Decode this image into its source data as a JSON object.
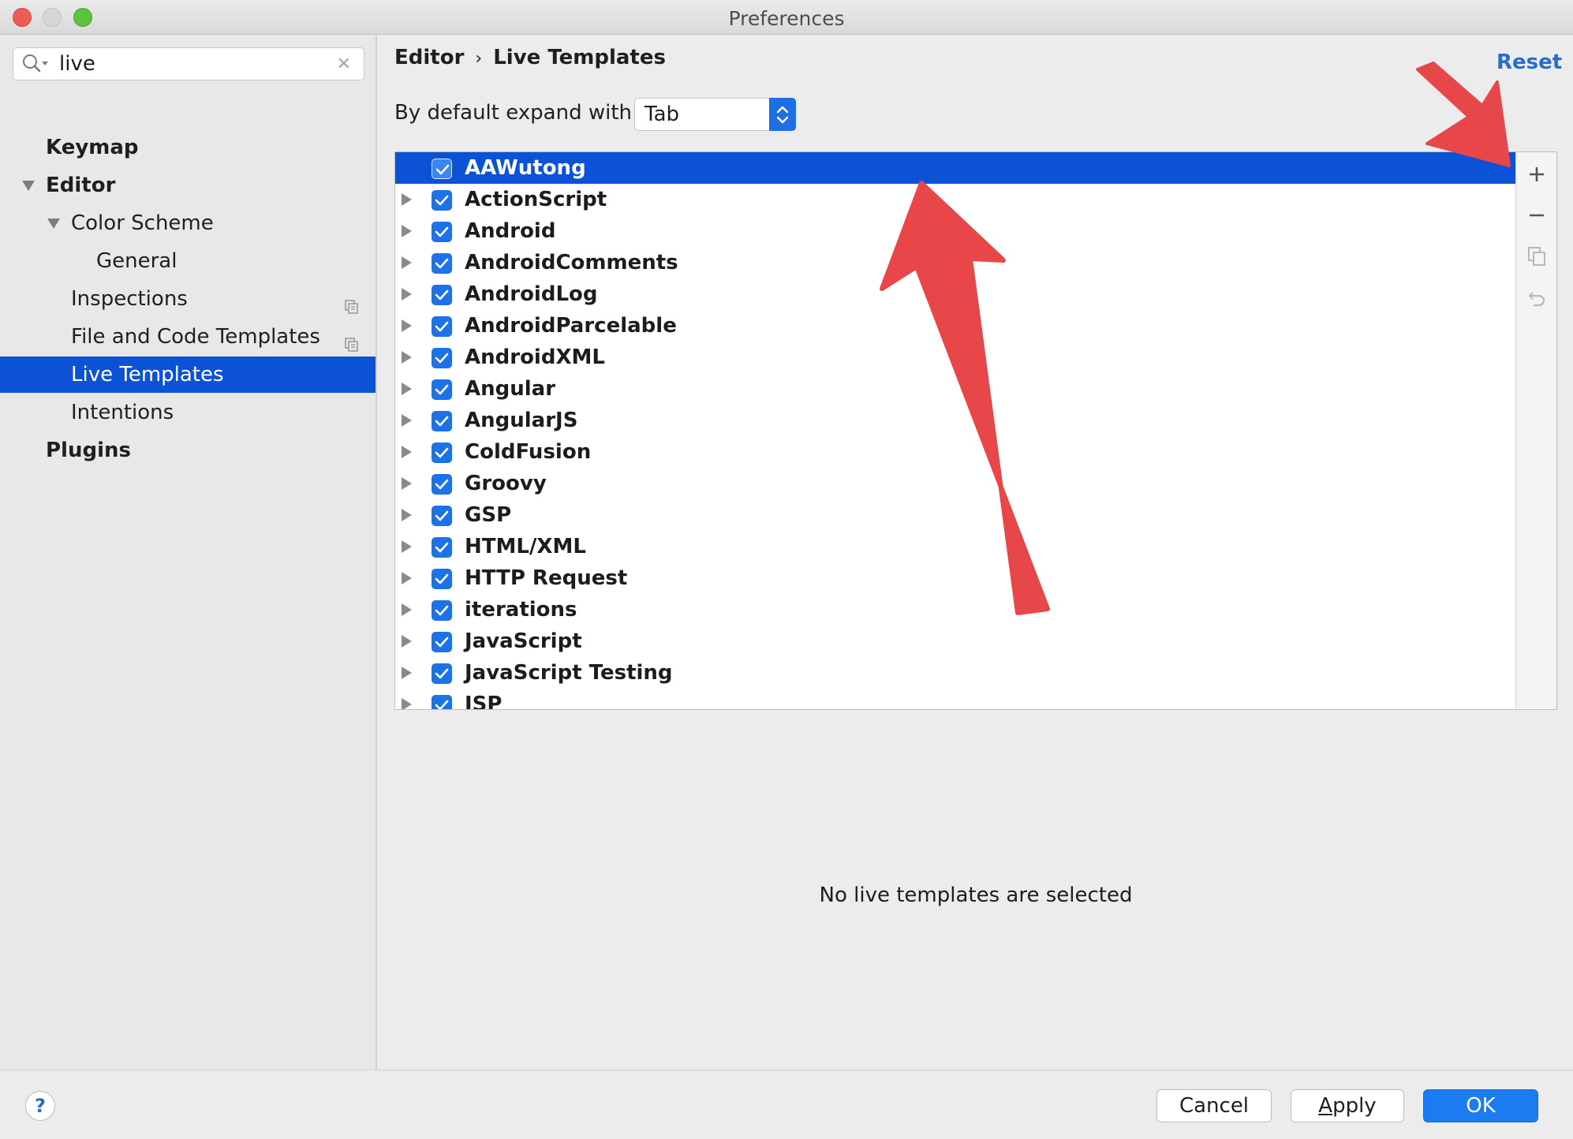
{
  "window": {
    "title": "Preferences"
  },
  "search": {
    "value": "live"
  },
  "sidebar": {
    "items": [
      {
        "label": "Keymap"
      },
      {
        "label": "Editor"
      },
      {
        "label": "Color Scheme"
      },
      {
        "label": "General"
      },
      {
        "label": "Inspections"
      },
      {
        "label": "File and Code Templates"
      },
      {
        "label": "Live Templates"
      },
      {
        "label": "Intentions"
      },
      {
        "label": "Plugins"
      }
    ]
  },
  "breadcrumb": {
    "parent": "Editor",
    "separator": "›",
    "current": "Live Templates"
  },
  "reset": {
    "label": "Reset"
  },
  "expand": {
    "label": "By default expand with",
    "value": "Tab"
  },
  "templates": [
    {
      "name": "AAWutong",
      "checked": true
    },
    {
      "name": "ActionScript",
      "checked": true
    },
    {
      "name": "Android",
      "checked": true
    },
    {
      "name": "AndroidComments",
      "checked": true
    },
    {
      "name": "AndroidLog",
      "checked": true
    },
    {
      "name": "AndroidParcelable",
      "checked": true
    },
    {
      "name": "AndroidXML",
      "checked": true
    },
    {
      "name": "Angular",
      "checked": true
    },
    {
      "name": "AngularJS",
      "checked": true
    },
    {
      "name": "ColdFusion",
      "checked": true
    },
    {
      "name": "Groovy",
      "checked": true
    },
    {
      "name": "GSP",
      "checked": true
    },
    {
      "name": "HTML/XML",
      "checked": true
    },
    {
      "name": "HTTP Request",
      "checked": true
    },
    {
      "name": "iterations",
      "checked": true
    },
    {
      "name": "JavaScript",
      "checked": true
    },
    {
      "name": "JavaScript Testing",
      "checked": true
    },
    {
      "name": "JSP",
      "checked": true
    }
  ],
  "tools": {
    "add": "plus-icon",
    "remove": "minus-icon",
    "copy": "copy-icon",
    "restore": "undo-icon"
  },
  "empty_message": "No live templates are selected",
  "buttons": {
    "help": "?",
    "cancel": "Cancel",
    "apply": "Apply",
    "ok": "OK"
  },
  "colors": {
    "accent": "#0c52d6",
    "checkbox": "#1c72e9",
    "link": "#2a6dc9",
    "annotation_arrow": "#e8474a"
  }
}
